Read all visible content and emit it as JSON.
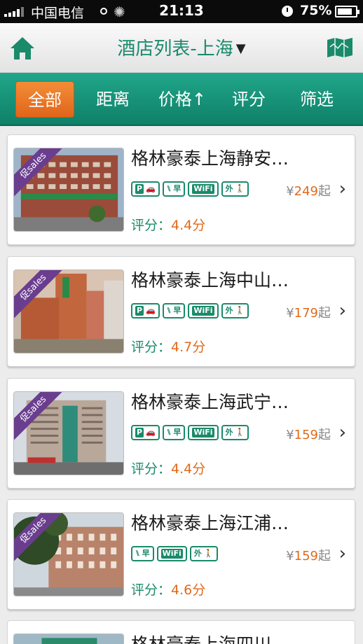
{
  "status_bar": {
    "carrier": "中国电信",
    "time": "21:13",
    "battery": "75%"
  },
  "header": {
    "title": "酒店列表-上海",
    "home_icon": "home-icon",
    "map_icon": "map-icon"
  },
  "filters": [
    {
      "label": "全部",
      "active": true
    },
    {
      "label": "距离",
      "active": false
    },
    {
      "label": "价格↑",
      "active": false
    },
    {
      "label": "评分",
      "active": false
    },
    {
      "label": "筛选",
      "active": false
    }
  ],
  "colors": {
    "brand_green": "#1a8a6a",
    "accent_orange": "#e06a1b",
    "promo_purple": "#6a3d8e"
  },
  "hotels": [
    {
      "name": "格林豪泰上海静安…",
      "badge": "促sales",
      "price_symbol": "¥",
      "price": "249",
      "price_suffix": "起",
      "rating_label": "评分：",
      "rating": "4.4分",
      "amenities": [
        "P",
        "早",
        "WiFi",
        "外"
      ]
    },
    {
      "name": "格林豪泰上海中山…",
      "badge": "促sales",
      "price_symbol": "¥",
      "price": "179",
      "price_suffix": "起",
      "rating_label": "评分：",
      "rating": "4.7分",
      "amenities": [
        "P",
        "早",
        "WiFi",
        "外"
      ]
    },
    {
      "name": "格林豪泰上海武宁…",
      "badge": "促sales",
      "price_symbol": "¥",
      "price": "159",
      "price_suffix": "起",
      "rating_label": "评分：",
      "rating": "4.4分",
      "amenities": [
        "P",
        "早",
        "WiFi",
        "外"
      ]
    },
    {
      "name": "格林豪泰上海江浦…",
      "badge": "促sales",
      "price_symbol": "¥",
      "price": "159",
      "price_suffix": "起",
      "rating_label": "评分：",
      "rating": "4.6分",
      "amenities": [
        "早",
        "WiFi",
        "外"
      ]
    },
    {
      "name": "格林豪泰上海四川…"
    }
  ]
}
